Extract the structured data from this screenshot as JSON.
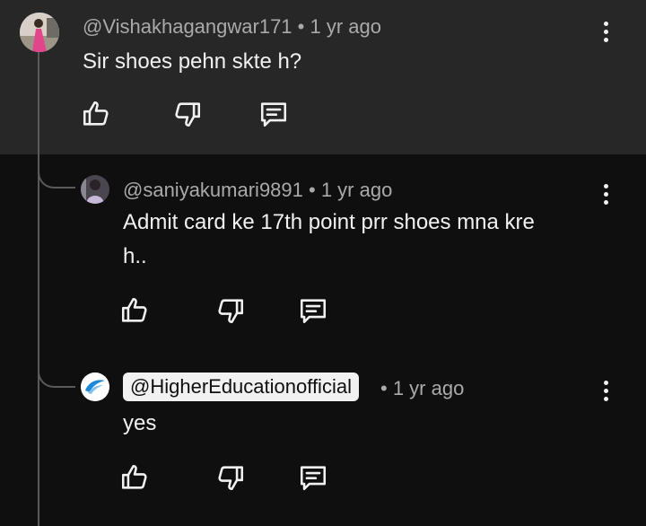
{
  "comments": [
    {
      "handle": "@Vishakhagangwar171",
      "time": "• 1 yr ago",
      "text": "Sir shoes pehn skte h?"
    },
    {
      "handle": "@saniyakumari9891",
      "time": "• 1 yr ago",
      "text_line1": "Admit card ke 17th point prr shoes mna kre",
      "text_line2": "h.."
    },
    {
      "handle": "@HigherEducationofficial",
      "time": "• 1 yr ago",
      "text": "yes"
    }
  ],
  "icons": {
    "like": "thumbs-up-icon",
    "dislike": "thumbs-down-icon",
    "reply": "reply-icon",
    "more": "more-vert-icon"
  },
  "colors": {
    "background": "#0f0f0f",
    "highlight": "#272727",
    "text": "#f1f1f1",
    "secondary": "#aaaaaa"
  }
}
